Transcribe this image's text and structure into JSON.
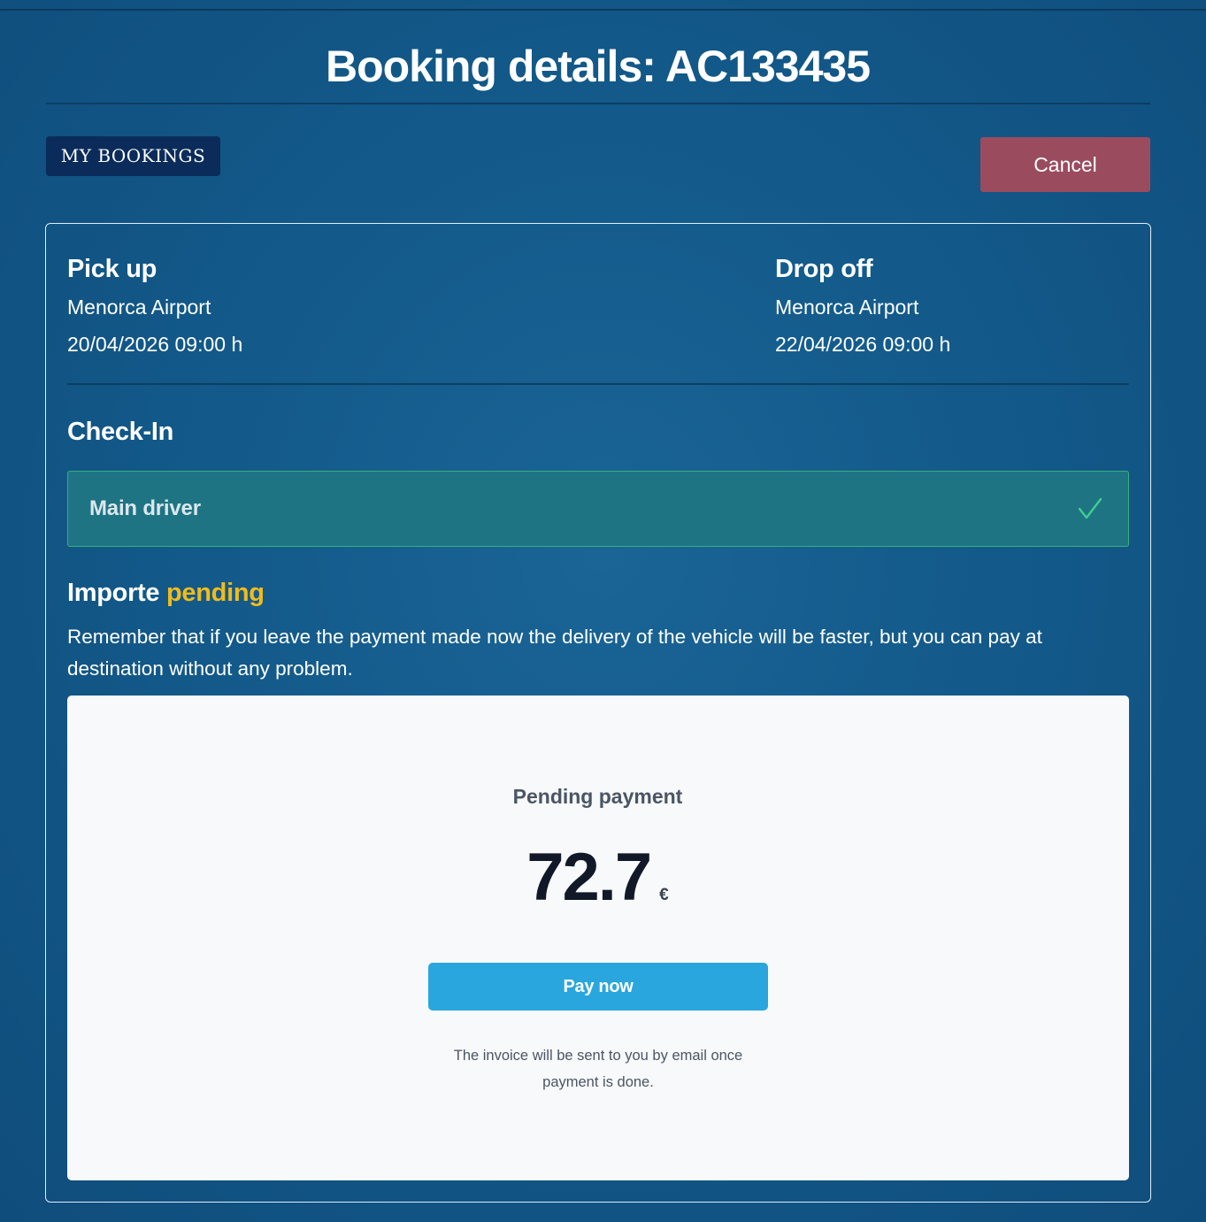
{
  "page": {
    "title": "Booking details: AC133435"
  },
  "header": {
    "my_bookings_label": "MY BOOKINGS",
    "cancel_label": "Cancel"
  },
  "pickup": {
    "heading": "Pick up",
    "location": "Menorca Airport",
    "datetime": "20/04/2026 09:00 h"
  },
  "dropoff": {
    "heading": "Drop off",
    "location": "Menorca Airport",
    "datetime": "22/04/2026 09:00 h"
  },
  "checkin": {
    "heading": "Check-In",
    "driver_label": "Main driver",
    "driver_status_icon": "check-icon",
    "driver_completed": true
  },
  "importe": {
    "heading_prefix": "Importe",
    "heading_status": "pending",
    "reminder": "Remember that if you leave the payment made now the delivery of the vehicle will be faster, but you can pay at destination without any problem."
  },
  "payment": {
    "label": "Pending payment",
    "amount": "72.7",
    "currency": "€",
    "pay_button_label": "Pay now",
    "invoice_note": "The invoice will be sent to you by email once payment is done."
  },
  "colors": {
    "background": "#135a8a",
    "cancel_button": "#9a4c5e",
    "my_bookings_button": "#0b2c5a",
    "pending_accent": "#f2bb1c",
    "checkin_box": "#1f7484",
    "checkin_border": "#35b07e",
    "pay_button": "#29a6dd",
    "panel_background": "#f7f9fb"
  }
}
